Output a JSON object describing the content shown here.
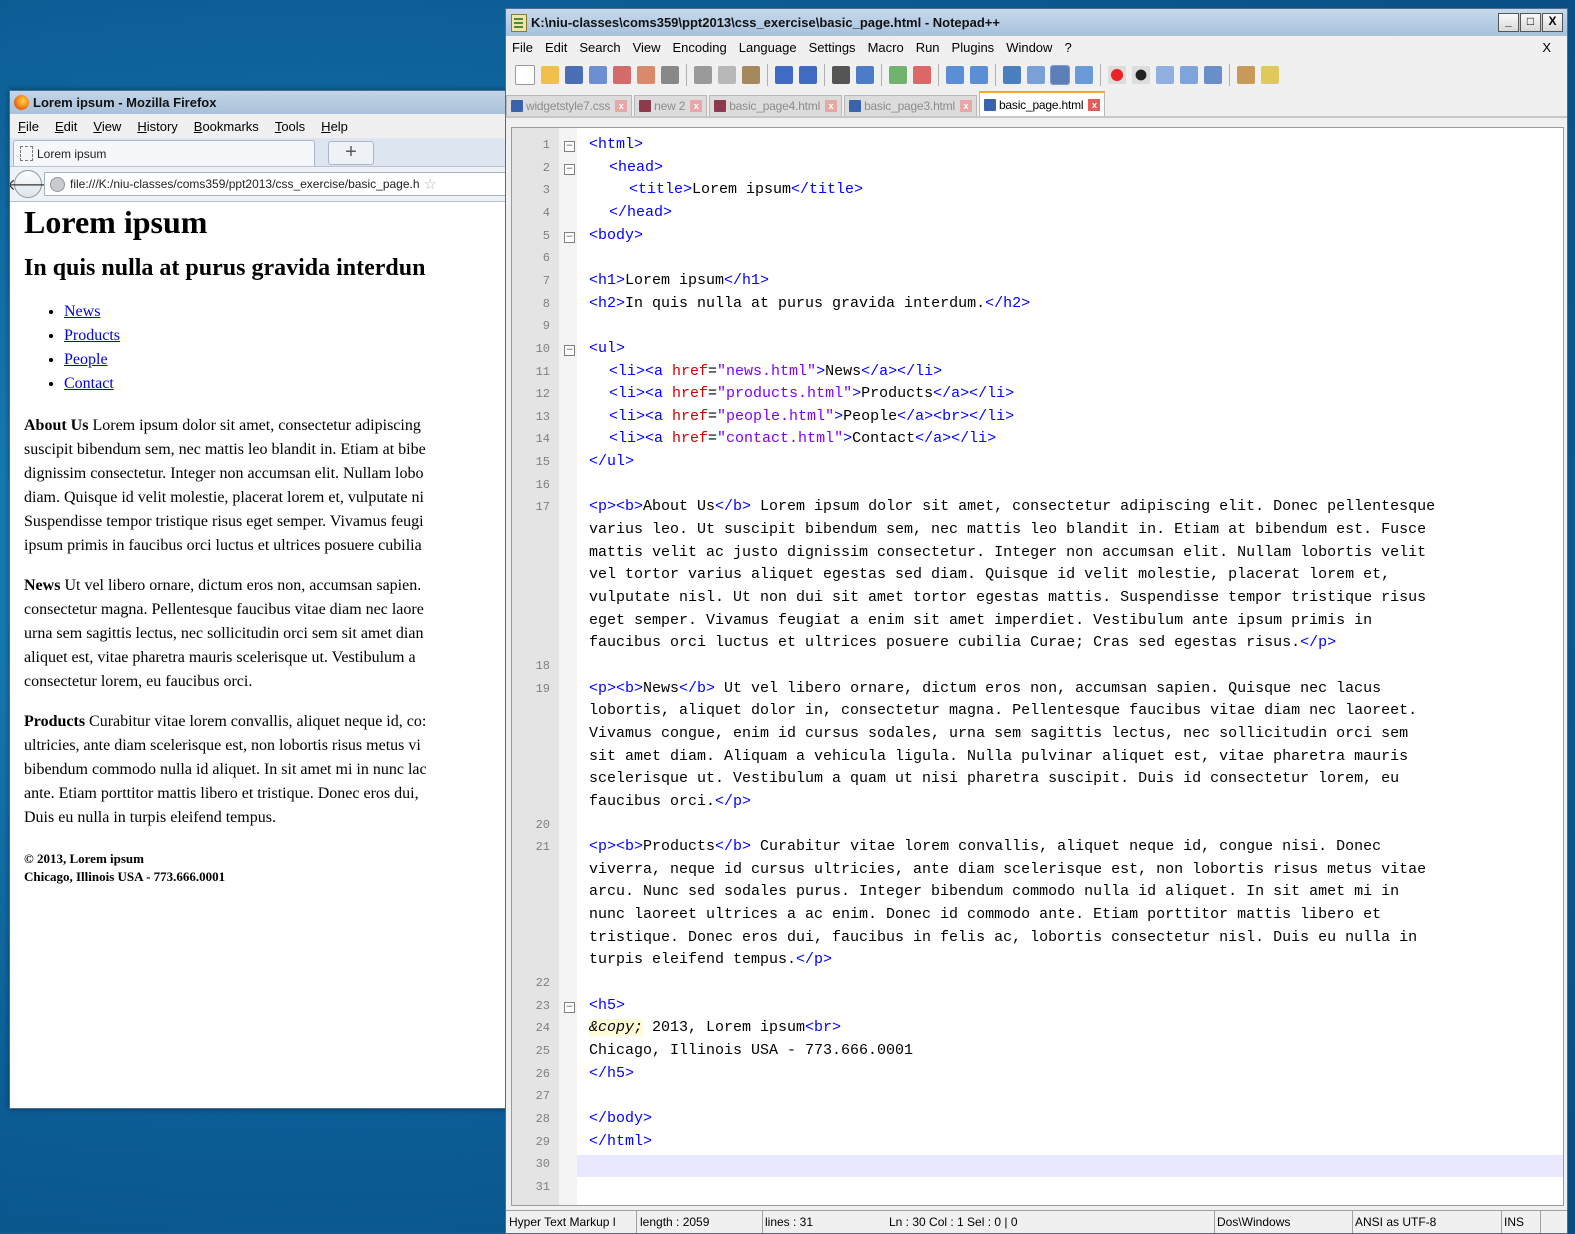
{
  "firefox": {
    "title": "Lorem ipsum - Mozilla Firefox",
    "menu": [
      "File",
      "Edit",
      "View",
      "History",
      "Bookmarks",
      "Tools",
      "Help"
    ],
    "tab_label": "Lorem ipsum",
    "new_tab": "+",
    "back": "🡐",
    "url": "file:///K:/niu-classes/coms359/ppt2013/css_exercise/basic_page.h",
    "h1": "Lorem ipsum",
    "h2": "In quis nulla at purus gravida interdun",
    "links": [
      "News",
      "Products",
      "People",
      "Contact"
    ],
    "paragraphs": [
      {
        "bold": "About Us",
        "lines": [
          " Lorem ipsum dolor sit amet, consectetur adipiscing",
          "suscipit bibendum sem, nec mattis leo blandit in. Etiam at bibe",
          "dignissim consectetur. Integer non accumsan elit. Nullam lobo",
          "diam. Quisque id velit molestie, placerat lorem et, vulputate ni",
          "Suspendisse tempor tristique risus eget semper. Vivamus feugi",
          "ipsum primis in faucibus orci luctus et ultrices posuere cubilia"
        ]
      },
      {
        "bold": "News",
        "lines": [
          " Ut vel libero ornare, dictum eros non, accumsan sapien.",
          "consectetur magna. Pellentesque faucibus vitae diam nec laore",
          "urna sem sagittis lectus, nec sollicitudin orci sem sit amet dian",
          "aliquet est, vitae pharetra mauris scelerisque ut. Vestibulum a",
          "consectetur lorem, eu faucibus orci."
        ]
      },
      {
        "bold": "Products",
        "lines": [
          " Curabitur vitae lorem convallis, aliquet neque id, co:",
          "ultricies, ante diam scelerisque est, non lobortis risus metus vi",
          "bibendum commodo nulla id aliquet. In sit amet mi in nunc lac",
          "ante. Etiam porttitor mattis libero et tristique. Donec eros dui,",
          "Duis eu nulla in turpis eleifend tempus."
        ]
      }
    ],
    "footer_line1": "© 2013, Lorem ipsum",
    "footer_line2": "Chicago, Illinois USA - 773.666.0001"
  },
  "notepad": {
    "title": "K:\\niu-classes\\coms359\\ppt2013\\css_exercise\\basic_page.html - Notepad++",
    "window_buttons": [
      "_",
      "□",
      "X"
    ],
    "menu": [
      "File",
      "Edit",
      "Search",
      "View",
      "Encoding",
      "Language",
      "Settings",
      "Macro",
      "Run",
      "Plugins",
      "Window",
      "?"
    ],
    "menu_close": "X",
    "tabs": [
      {
        "label": "widgetstyle7.css",
        "active": false
      },
      {
        "label": "new  2",
        "active": false
      },
      {
        "label": "basic_page4.html",
        "active": false
      },
      {
        "label": "basic_page3.html",
        "active": false
      },
      {
        "label": "basic_page.html",
        "active": true
      }
    ],
    "tab_close": "x",
    "line_numbers": [
      "1",
      "2",
      "3",
      "4",
      "5",
      "6",
      "7",
      "8",
      "9",
      "10",
      "11",
      "12",
      "13",
      "14",
      "15",
      "16",
      "17",
      "18",
      "19",
      "20",
      "21",
      "22",
      "23",
      "24",
      "25",
      "26",
      "27",
      "28",
      "29",
      "30",
      "31"
    ],
    "code": {
      "l1": [
        "<html>"
      ],
      "l2": [
        "<head>"
      ],
      "l3": [
        "<title>",
        "Lorem ipsum",
        "</title>"
      ],
      "l4": [
        "</head>"
      ],
      "l5": [
        "<body>"
      ],
      "l7": [
        "<h1>",
        "Lorem ipsum",
        "</h1>"
      ],
      "l8": [
        "<h2>",
        "In quis nulla at purus gravida interdum.",
        "</h2>"
      ],
      "l10": [
        "<ul>"
      ],
      "l11": [
        "<li><a ",
        "href",
        "=",
        "\"news.html\"",
        ">",
        "News",
        "</a></li>"
      ],
      "l12": [
        "<li><a ",
        "href",
        "=",
        "\"products.html\"",
        ">",
        "Products",
        "</a></li>"
      ],
      "l13": [
        "<li><a ",
        "href",
        "=",
        "\"people.html\"",
        ">",
        "People",
        "</a><br></li>"
      ],
      "l14": [
        "<li><a ",
        "href",
        "=",
        "\"contact.html\"",
        ">",
        "Contact",
        "</a></li>"
      ],
      "l15": [
        "</ul>"
      ],
      "p17": [
        "<p><b>|About Us|</b>| Lorem ipsum dolor sit amet, consectetur adipiscing elit. Donec pellentesque",
        "varius leo. Ut suscipit bibendum sem, nec mattis leo blandit in. Etiam at bibendum est. Fusce",
        "mattis velit ac justo dignissim consectetur. Integer non accumsan elit. Nullam lobortis velit",
        "vel tortor varius aliquet egestas sed diam. Quisque id velit molestie, placerat lorem et,",
        "vulputate nisl. Ut non dui sit amet tortor egestas mattis. Suspendisse tempor tristique risus",
        "eget semper. Vivamus feugiat a enim sit amet imperdiet. Vestibulum ante ipsum primis in",
        "faucibus orci luctus et ultrices posuere cubilia Curae; Cras sed egestas risus.|</p>"
      ],
      "p19": [
        "<p><b>|News|</b>| Ut vel libero ornare, dictum eros non, accumsan sapien. Quisque nec lacus",
        "lobortis, aliquet dolor in, consectetur magna. Pellentesque faucibus vitae diam nec laoreet.",
        "Vivamus congue, enim id cursus sodales, urna sem sagittis lectus, nec sollicitudin orci sem",
        "sit amet diam. Aliquam a vehicula ligula. Nulla pulvinar aliquet est, vitae pharetra mauris",
        "scelerisque ut. Vestibulum a quam ut nisi pharetra suscipit. Duis id consectetur lorem, eu",
        "faucibus orci.|</p>"
      ],
      "p21": [
        "<p><b>|Products|</b>| Curabitur vitae lorem convallis, aliquet neque id, congue nisi. Donec",
        "viverra, neque id cursus ultricies, ante diam scelerisque est, non lobortis risus metus vitae",
        "arcu. Nunc sed sodales purus. Integer bibendum commodo nulla id aliquet. In sit amet mi in",
        "nunc laoreet ultrices a ac enim. Donec id commodo ante. Etiam porttitor mattis libero et",
        "tristique. Donec eros dui, faucibus in felis ac, lobortis consectetur nisl. Duis eu nulla in",
        "turpis eleifend tempus.|</p>"
      ],
      "l23": [
        "<h5>"
      ],
      "l24": [
        "&copy;",
        " 2013, Lorem ipsum",
        "<br>"
      ],
      "l25": [
        "Chicago, Illinois USA - 773.666.0001"
      ],
      "l26": [
        "</h5>"
      ],
      "l28": [
        "</body>"
      ],
      "l29": [
        "</html>"
      ]
    },
    "status": {
      "lang": "Hyper Text Markup l",
      "length": "length : 2059",
      "lines": "lines : 31",
      "pos": "Ln : 30    Col : 1    Sel : 0 | 0",
      "eol": "Dos\\Windows",
      "enc": "ANSI as UTF-8",
      "mode": "INS"
    }
  }
}
